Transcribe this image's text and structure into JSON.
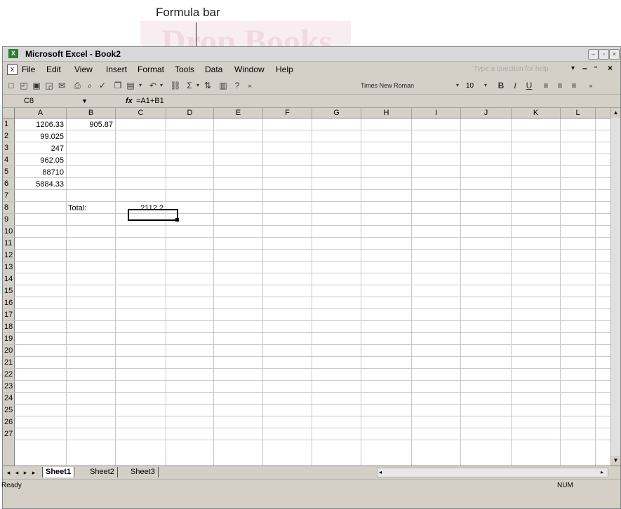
{
  "annotation": {
    "label": "Formula bar"
  },
  "watermark": {
    "text": "Drop Books"
  },
  "window": {
    "title": "Microsoft Excel - Book2",
    "app_icon": "excel-icon",
    "controls": [
      "minimize",
      "restore",
      "close"
    ]
  },
  "menu": {
    "items": [
      "File",
      "Edit",
      "View",
      "Insert",
      "Format",
      "Tools",
      "Data",
      "Window",
      "Help"
    ],
    "help_placeholder": "Type a question for help"
  },
  "toolbar": {
    "font_name": "Times New Roman",
    "font_size": "10",
    "bold": "B",
    "italic": "I",
    "underline": "U",
    "sum": "Σ",
    "icons": [
      "new-icon",
      "open-icon",
      "save-icon",
      "permission-icon",
      "email-icon",
      "print-icon",
      "print-preview-icon",
      "spelling-icon",
      "copy-icon",
      "paste-icon",
      "undo-icon",
      "hyperlink-icon",
      "autosum-icon",
      "sort-ascending-icon",
      "chart-wizard-icon",
      "help-icon",
      "align-left-icon",
      "center-icon",
      "align-right-icon"
    ]
  },
  "formula_bar": {
    "name_box": "C8",
    "fx": "fx",
    "formula": "=A1+B1"
  },
  "grid": {
    "columns": [
      "A",
      "B",
      "C",
      "D",
      "E",
      "F",
      "G",
      "H",
      "I",
      "J",
      "K",
      "L"
    ],
    "rows": [
      "1",
      "2",
      "3",
      "4",
      "5",
      "6",
      "7",
      "8",
      "9",
      "10",
      "11",
      "12",
      "13",
      "14",
      "15",
      "16",
      "17",
      "18",
      "19",
      "20",
      "21",
      "22",
      "23",
      "24",
      "25",
      "26",
      "27"
    ],
    "cells": {
      "A1": "1206.33",
      "B1": "905.87",
      "A2": "99.025",
      "A3": "247",
      "A4": "962.05",
      "A5": "88710",
      "A6": "5884.33",
      "B8": "Total:",
      "C8": "2112.2"
    },
    "active_cell": "C8"
  },
  "sheets": {
    "tabs": [
      "Sheet1",
      "Sheet2",
      "Sheet3"
    ],
    "active": "Sheet1"
  },
  "status": {
    "ready": "Ready",
    "num": "NUM"
  }
}
